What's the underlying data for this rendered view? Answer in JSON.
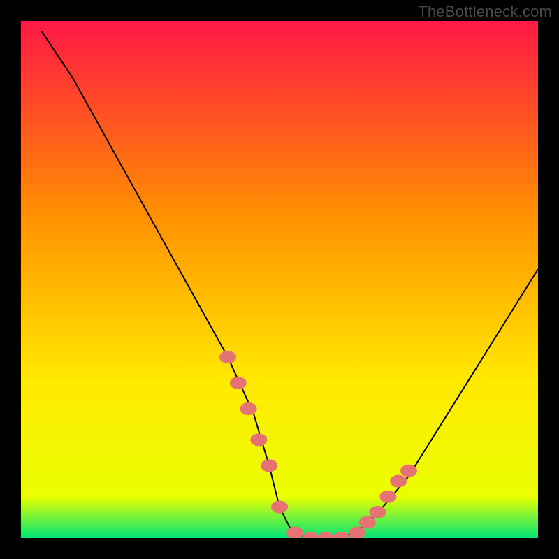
{
  "watermark": "TheBottleneck.com",
  "chart_data": {
    "type": "line",
    "title": "",
    "xlabel": "",
    "ylabel": "",
    "xlim": [
      0,
      100
    ],
    "ylim": [
      0,
      100
    ],
    "background_gradient": {
      "top": "#ff1744",
      "mid1": "#ff9100",
      "mid2": "#ffea00",
      "bottom": "#00e676"
    },
    "series": [
      {
        "name": "curve",
        "color": "#000000",
        "x": [
          4,
          10,
          15,
          20,
          25,
          30,
          35,
          40,
          45,
          48,
          50,
          52,
          55,
          58,
          62,
          66,
          70,
          75,
          80,
          85,
          90,
          95,
          100
        ],
        "values": [
          98,
          89,
          80,
          71,
          62,
          53,
          44,
          35,
          24,
          14,
          6,
          2,
          0,
          0,
          0,
          2,
          6,
          12,
          20,
          28,
          36,
          44,
          52
        ]
      }
    ],
    "markers": {
      "name": "highlighted-points",
      "color": "#e57373",
      "x": [
        40,
        42,
        44,
        46,
        48,
        50,
        53,
        56,
        59,
        62,
        65,
        67,
        69,
        71,
        73,
        75
      ],
      "values": [
        35,
        30,
        25,
        19,
        14,
        6,
        1,
        0,
        0,
        0,
        1,
        3,
        5,
        8,
        11,
        13
      ]
    }
  }
}
